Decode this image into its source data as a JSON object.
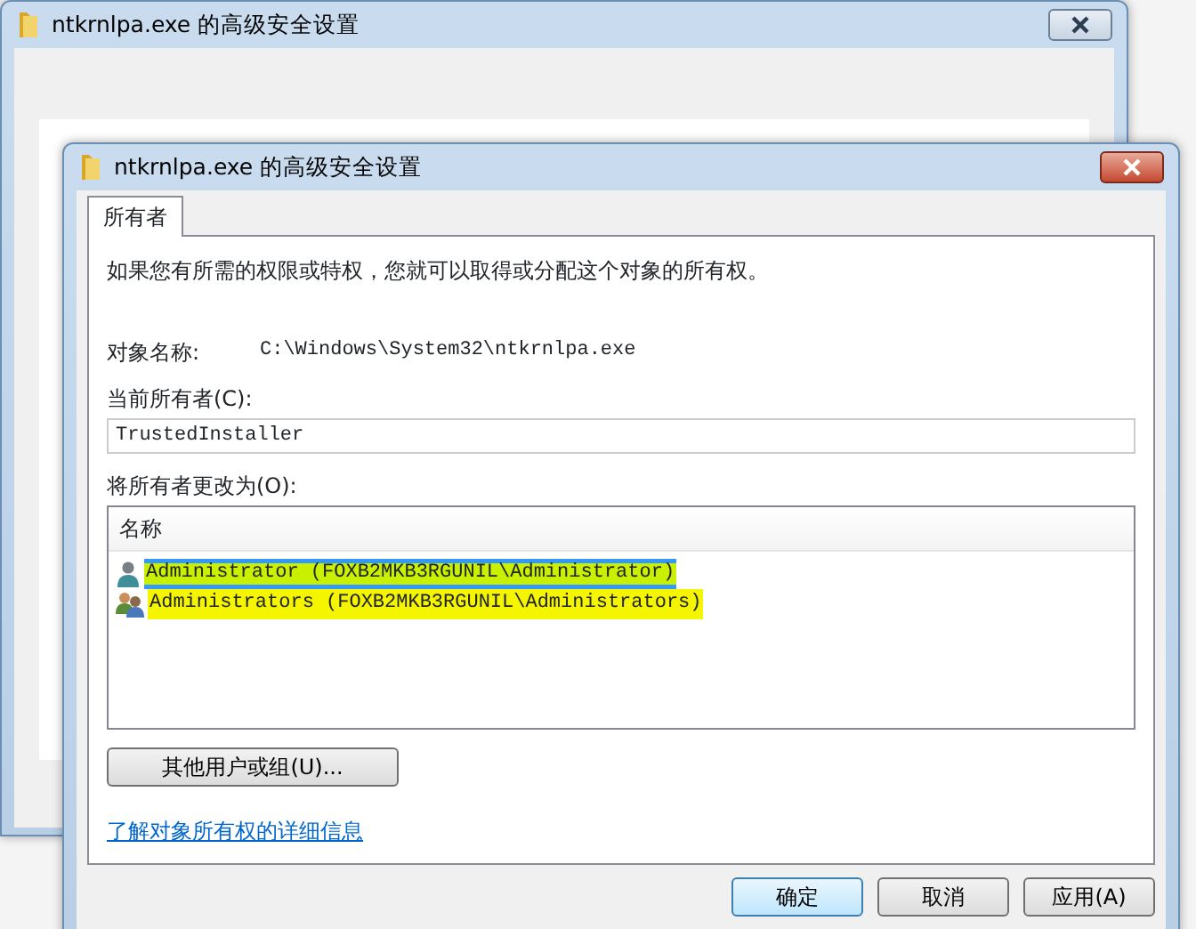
{
  "back_window": {
    "title": "ntkrnlpa.exe 的高级安全设置"
  },
  "window": {
    "title": "ntkrnlpa.exe 的高级安全设置"
  },
  "tabs": [
    {
      "label": "所有者",
      "selected": true
    }
  ],
  "intro": "如果您有所需的权限或特权，您就可以取得或分配这个对象的所有权。",
  "object_name": {
    "label": "对象名称:",
    "value": "C:\\Windows\\System32\\ntkrnlpa.exe"
  },
  "current_owner": {
    "label": "当前所有者(C):",
    "value": "TrustedInstaller"
  },
  "change_owner": {
    "label": "将所有者更改为(O):",
    "column": "名称",
    "rows": [
      {
        "kind": "user",
        "name": "Administrator (FOXB2MKB3RGUNIL\\Administrator)",
        "selected": true,
        "highlighted": true
      },
      {
        "kind": "group",
        "name": "Administrators (FOXB2MKB3RGUNIL\\Administrators)",
        "selected": false,
        "highlighted": true
      }
    ]
  },
  "other_button": "其他用户或组(U)...",
  "link": "了解对象所有权的详细信息",
  "buttons": [
    {
      "label": "确定",
      "default": true
    },
    {
      "label": "取消",
      "default": false
    },
    {
      "label": "应用(A)",
      "default": false
    }
  ]
}
